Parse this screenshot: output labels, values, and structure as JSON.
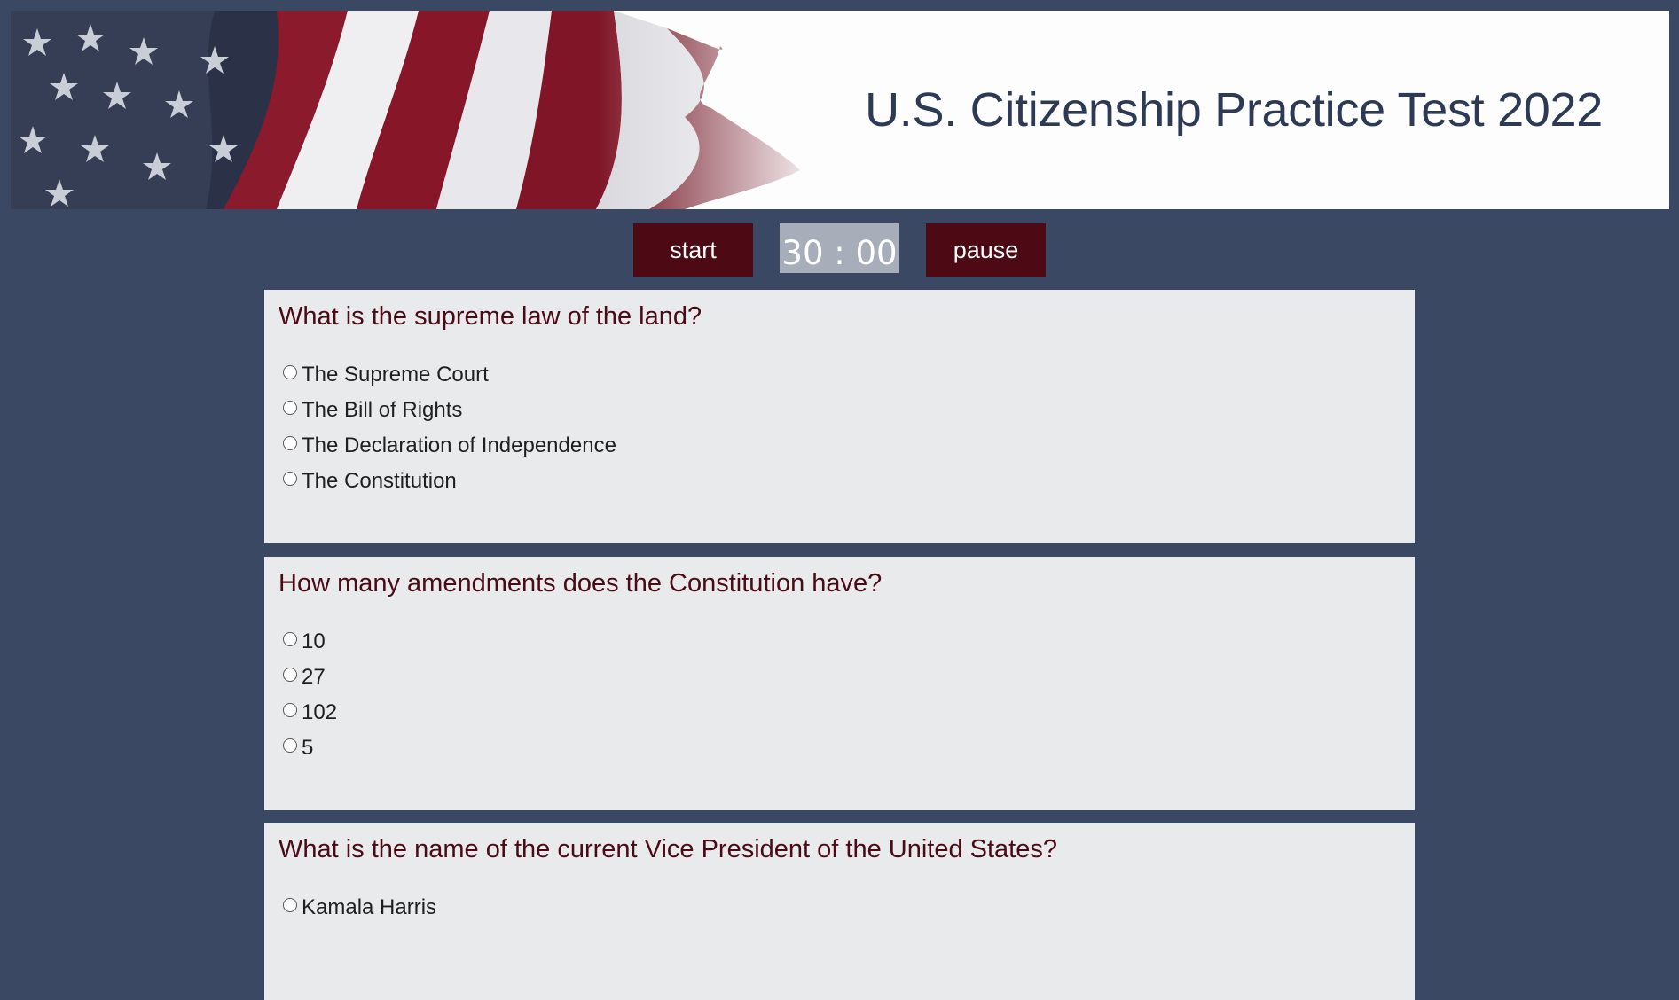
{
  "header": {
    "title": "U.S. Citizenship Practice Test 2022"
  },
  "controls": {
    "start_label": "start",
    "timer_text": "30 : 00",
    "pause_label": "pause"
  },
  "questions": [
    {
      "text": "What is the supreme law of the land?",
      "options": [
        "The Supreme Court",
        "The Bill of Rights",
        "The Declaration of Independence",
        "The Constitution"
      ]
    },
    {
      "text": "How many amendments does the Constitution have?",
      "options": [
        "10",
        "27",
        "102",
        "5"
      ]
    },
    {
      "text": "What is the name of the current Vice President of the United States?",
      "options": [
        "Kamala Harris"
      ]
    }
  ],
  "colors": {
    "background": "#3b4863",
    "button": "#4d0a14",
    "card": "#e9eaec",
    "question_text": "#4a0b16",
    "title_text": "#2d3a55"
  }
}
